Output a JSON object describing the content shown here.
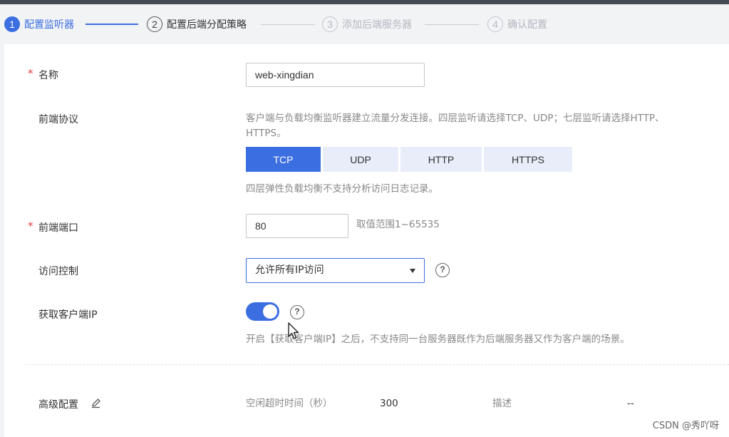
{
  "steps": [
    {
      "num": "1",
      "label": "配置监听器"
    },
    {
      "num": "2",
      "label": "配置后端分配策略"
    },
    {
      "num": "3",
      "label": "添加后端服务器"
    },
    {
      "num": "4",
      "label": "确认配置"
    }
  ],
  "form": {
    "required_mark": "*",
    "name": {
      "label": "名称",
      "value": "web-xingdian"
    },
    "protocol": {
      "label": "前端协议",
      "hint_line1": "客户端与负载均衡监听器建立流量分发连接。四层监听请选择TCP、UDP；七层监听请选择HTTP、",
      "hint_line2": "HTTPS。",
      "options": [
        "TCP",
        "UDP",
        "HTTP",
        "HTTPS"
      ],
      "selected": "TCP",
      "note": "四层弹性负载均衡不支持分析访问日志记录。"
    },
    "port": {
      "label": "前端端口",
      "value": "80",
      "range_hint": "取值范围1~65535"
    },
    "access": {
      "label": "访问控制",
      "value": "允许所有IP访问"
    },
    "client_ip": {
      "label": "获取客户端IP",
      "enabled": true,
      "hint": "开启【获取客户端IP】之后，不支持同一台服务器既作为后端服务器又作为客户端的场景。"
    },
    "help_glyph": "?",
    "advanced": {
      "label": "高级配置",
      "idle_label": "空闲超时时间（秒）",
      "idle_value": "300",
      "desc_label": "描述",
      "desc_value": "--"
    }
  },
  "watermark": "CSDN @秀吖呀",
  "colors": {
    "accent": "#3b6ee0",
    "required": "#e0423f",
    "segment_bg": "#e8edf9"
  },
  "icons": [
    "pencil-icon",
    "help-icon",
    "cursor-icon"
  ]
}
